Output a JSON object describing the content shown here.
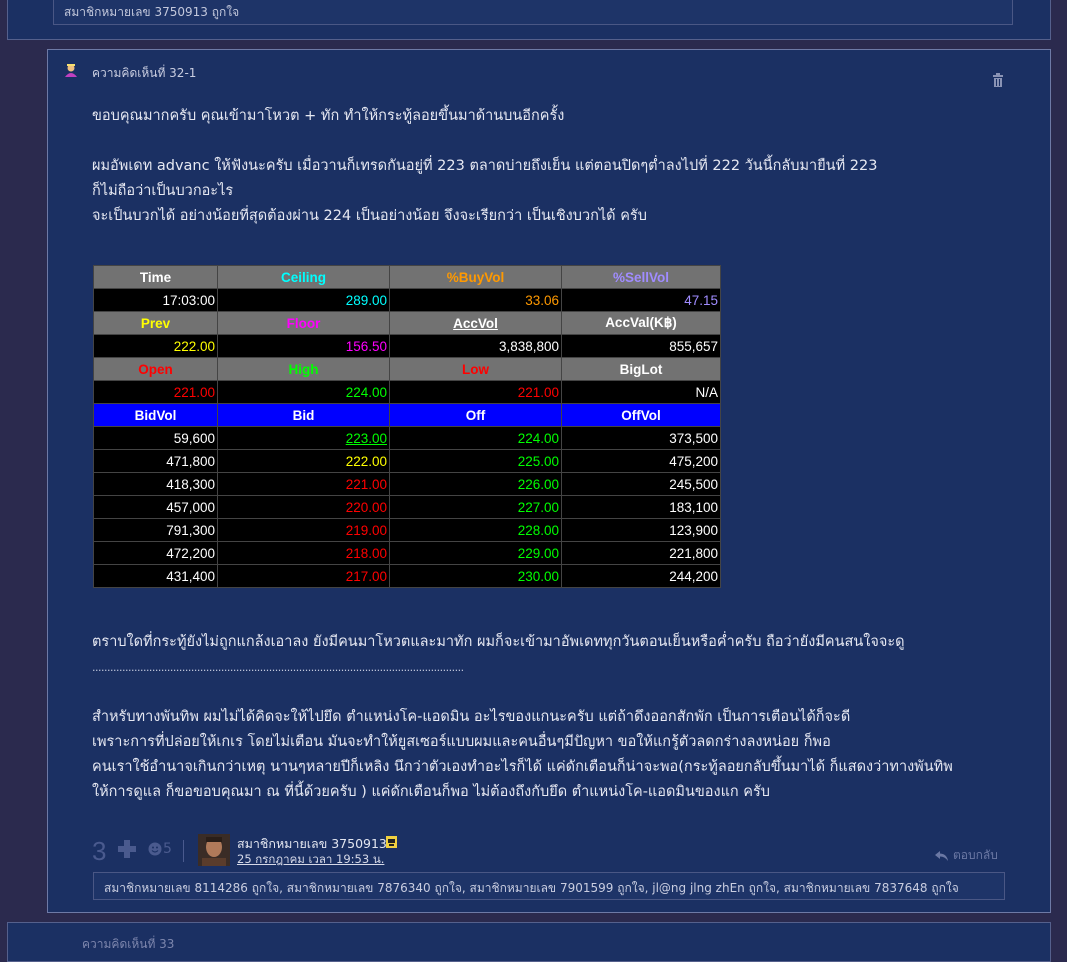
{
  "prev_post": {
    "likes_text": "สมาชิกหมายเลข 3750913 ถูกใจ"
  },
  "post": {
    "comment_no": "ความคิดเห็นที่ 32-1",
    "paragraphs": [
      "ขอบคุณมากครับ คุณเข้ามาโหวต + ทัก ทำให้กระทู้ลอยขึ้นมาด้านบนอีกครั้ง",
      "",
      "ผมอัพเดท advanc ให้ฟังนะครับ เมื่อวานก็เทรดกันอยู่ที่ 223 ตลาดบ่ายถึงเย็น แต่ตอนปิดๆต่ำลงไปที่ 222 วันนี้กลับมายืนที่ 223",
      "ก็ไม่ถือว่าเป็นบวกอะไร",
      "จะเป็นบวกได้ อย่างน้อยที่สุดต้องผ่าน 224 เป็นอย่างน้อย จึงจะเรียกว่า เป็นเชิงบวกได้ ครับ"
    ],
    "after_table": [
      "ตราบใดที่กระทู้ยังไม่ถูกแกล้งเอาลง ยังมีคนมาโหวตและมาทัก ผมก็จะเข้ามาอัพเดททุกวันตอนเย็นหรือค่ำครับ ถือว่ายังมีคนสนใจจะดู",
      "............................................................................................................................",
      "",
      "สำหรับทางพันทิพ ผมไม่ได้คิดจะให้ไปยึด ตำแหน่งโค-แอดมิน อะไรของแกนะครับ แต่ถ้าดึงออกสักพัก เป็นการเตือนได้ก็จะดี",
      "เพราะการที่ปล่อยให้เกเร โดยไม่เตือน มันจะทำให้ยูสเซอร์แบบผมและคนอื่นๆมีปัญหา ขอให้แกรู้ตัวลดกร่างลงหน่อย ก็พอ",
      "คนเราใช้อำนาจเกินกว่าเหตุ นานๆหลายปีก็เหลิง นึกว่าตัวเองทำอะไรก็ได้ แค่ดักเตือนก็น่าจะพอ(กระทู้ลอยกลับขึ้นมาได้ ก็แสดงว่าทางพันทิพ",
      "ให้การดูแล ก็ขอขอบคุณมา ณ ที่นี้ด้วยครับ ) แค่ดักเตือนก็พอ  ไม่ต้องถึงกับยึด ตำแหน่งโค-แอดมินของแก ครับ"
    ],
    "stock": {
      "h1": [
        "Time",
        "Ceiling",
        "%BuyVol",
        "%SellVol"
      ],
      "r1": [
        "17:03:00",
        "289.00",
        "33.06",
        "47.15"
      ],
      "h2": [
        "Prev",
        "Floor",
        "AccVol",
        "AccVal(K฿)"
      ],
      "r2": [
        "222.00",
        "156.50",
        "3,838,800",
        "855,657"
      ],
      "h3": [
        "Open",
        "High",
        "Low",
        "BigLot"
      ],
      "r3": [
        "221.00",
        "224.00",
        "221.00",
        "N/A"
      ],
      "h4": [
        "BidVol",
        "Bid",
        "Off",
        "OffVol"
      ],
      "rows": [
        [
          "59,600",
          "223.00",
          "224.00",
          "373,500"
        ],
        [
          "471,800",
          "222.00",
          "225.00",
          "475,200"
        ],
        [
          "418,300",
          "221.00",
          "226.00",
          "245,500"
        ],
        [
          "457,000",
          "220.00",
          "227.00",
          "183,100"
        ],
        [
          "791,300",
          "219.00",
          "228.00",
          "123,900"
        ],
        [
          "472,200",
          "218.00",
          "229.00",
          "221,800"
        ],
        [
          "431,400",
          "217.00",
          "230.00",
          "244,200"
        ]
      ],
      "colors": {
        "ceiling": "#00ffff",
        "buy": "#ff9900",
        "sell": "#a08cff",
        "prev": "#ffff00",
        "floor": "#ff00ff",
        "open": "#ff0000",
        "high": "#00ff00",
        "low": "#ff0000",
        "bid_up": "#00ff00",
        "bid_same": "#ffff00",
        "bid_down": "#ff0000",
        "off": "#00ff00"
      }
    },
    "footer": {
      "like_count": "3",
      "smile_count": "5",
      "user_name": "สมาชิกหมายเลข 3750913",
      "date": "25 กรกฎาคม เวลา 19:53 น.",
      "reply_label": "ตอบกลับ",
      "likes_text": "สมาชิกหมายเลข 8114286 ถูกใจ, สมาชิกหมายเลข 7876340 ถูกใจ, สมาชิกหมายเลข 7901599 ถูกใจ, jl@ng jlng zhEn ถูกใจ, สมาชิกหมายเลข 7837648 ถูกใจ"
    }
  },
  "next_post": {
    "comment_no": "ความคิดเห็นที่ 33"
  }
}
